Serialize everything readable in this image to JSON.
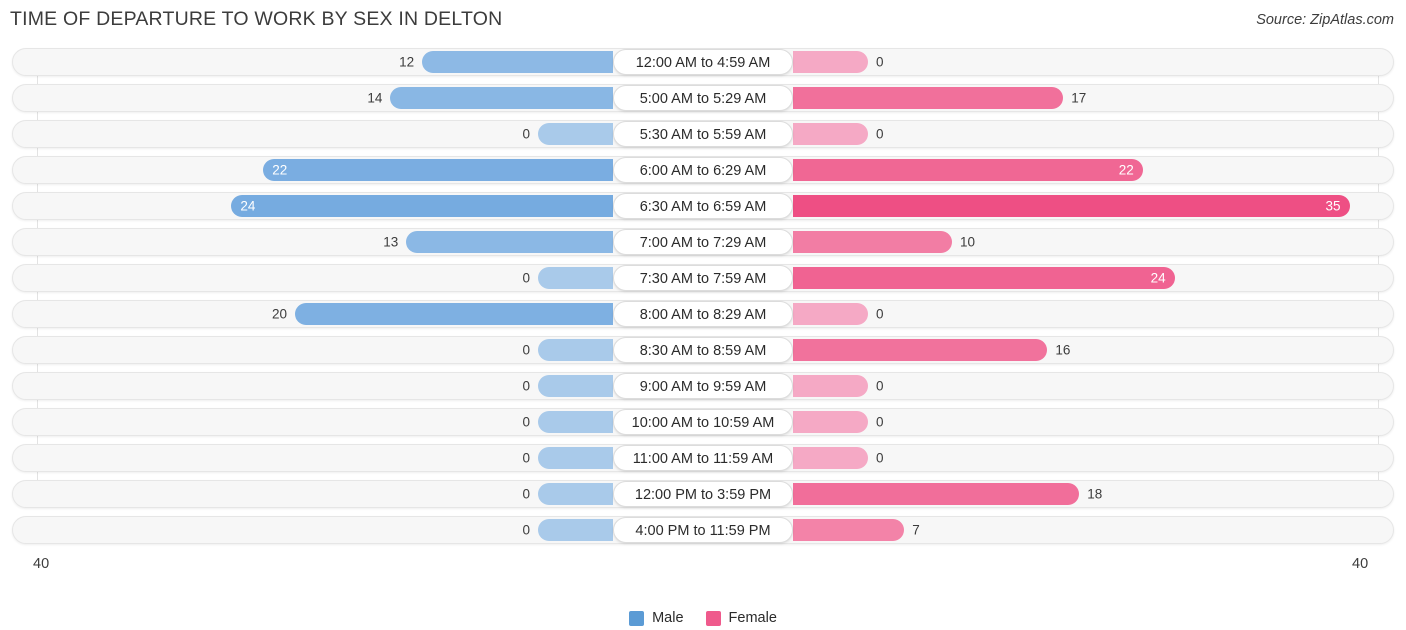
{
  "header": {
    "title": "TIME OF DEPARTURE TO WORK BY SEX IN DELTON",
    "source": "Source: ZipAtlas.com"
  },
  "legend": {
    "male_label": "Male",
    "female_label": "Female",
    "male_color": "#5b9bd5",
    "female_color": "#ef5a8c"
  },
  "axis": {
    "left_max": "40",
    "right_max": "40"
  },
  "chart_data": {
    "type": "bar",
    "orientation": "horizontal-diverging",
    "title": "TIME OF DEPARTURE TO WORK BY SEX IN DELTON",
    "xlabel": "",
    "ylabel": "",
    "xlim": [
      40,
      40
    ],
    "grid": true,
    "legend_position": "bottom-center",
    "categories": [
      "12:00 AM to 4:59 AM",
      "5:00 AM to 5:29 AM",
      "5:30 AM to 5:59 AM",
      "6:00 AM to 6:29 AM",
      "6:30 AM to 6:59 AM",
      "7:00 AM to 7:29 AM",
      "7:30 AM to 7:59 AM",
      "8:00 AM to 8:29 AM",
      "8:30 AM to 8:59 AM",
      "9:00 AM to 9:59 AM",
      "10:00 AM to 10:59 AM",
      "11:00 AM to 11:59 AM",
      "12:00 PM to 3:59 PM",
      "4:00 PM to 11:59 PM"
    ],
    "series": [
      {
        "name": "Male",
        "values": [
          12,
          14,
          0,
          22,
          24,
          13,
          0,
          20,
          0,
          0,
          0,
          0,
          0,
          0
        ]
      },
      {
        "name": "Female",
        "values": [
          0,
          17,
          0,
          22,
          35,
          10,
          24,
          0,
          16,
          0,
          0,
          0,
          18,
          7
        ]
      }
    ]
  },
  "rows": [
    {
      "label": "12:00 AM to 4:59 AM",
      "male": "12",
      "female": "0"
    },
    {
      "label": "5:00 AM to 5:29 AM",
      "male": "14",
      "female": "17"
    },
    {
      "label": "5:30 AM to 5:59 AM",
      "male": "0",
      "female": "0"
    },
    {
      "label": "6:00 AM to 6:29 AM",
      "male": "22",
      "female": "22"
    },
    {
      "label": "6:30 AM to 6:59 AM",
      "male": "24",
      "female": "35"
    },
    {
      "label": "7:00 AM to 7:29 AM",
      "male": "13",
      "female": "10"
    },
    {
      "label": "7:30 AM to 7:59 AM",
      "male": "0",
      "female": "24"
    },
    {
      "label": "8:00 AM to 8:29 AM",
      "male": "20",
      "female": "0"
    },
    {
      "label": "8:30 AM to 8:59 AM",
      "male": "0",
      "female": "16"
    },
    {
      "label": "9:00 AM to 9:59 AM",
      "male": "0",
      "female": "0"
    },
    {
      "label": "10:00 AM to 10:59 AM",
      "male": "0",
      "female": "0"
    },
    {
      "label": "11:00 AM to 11:59 AM",
      "male": "0",
      "female": "0"
    },
    {
      "label": "12:00 PM to 3:59 PM",
      "male": "0",
      "female": "18"
    },
    {
      "label": "4:00 PM to 11:59 PM",
      "male": "0",
      "female": "7"
    }
  ]
}
